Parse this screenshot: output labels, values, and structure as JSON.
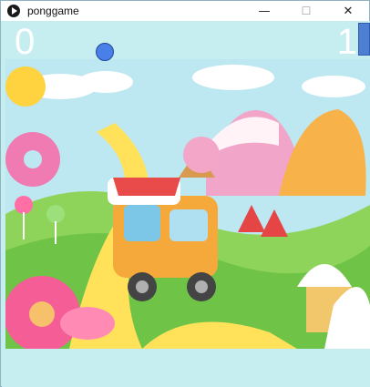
{
  "window": {
    "title": "ponggame",
    "icon": "play-icon",
    "controls": {
      "minimize": "—",
      "maximize": "☐",
      "close": "✕"
    }
  },
  "game": {
    "score_left": "0",
    "score_right": "1"
  },
  "colors": {
    "background": "#c6edf0",
    "paddle": "#4f7fd3",
    "ball": "#4a7fe8",
    "score_text": "#ffffff"
  }
}
